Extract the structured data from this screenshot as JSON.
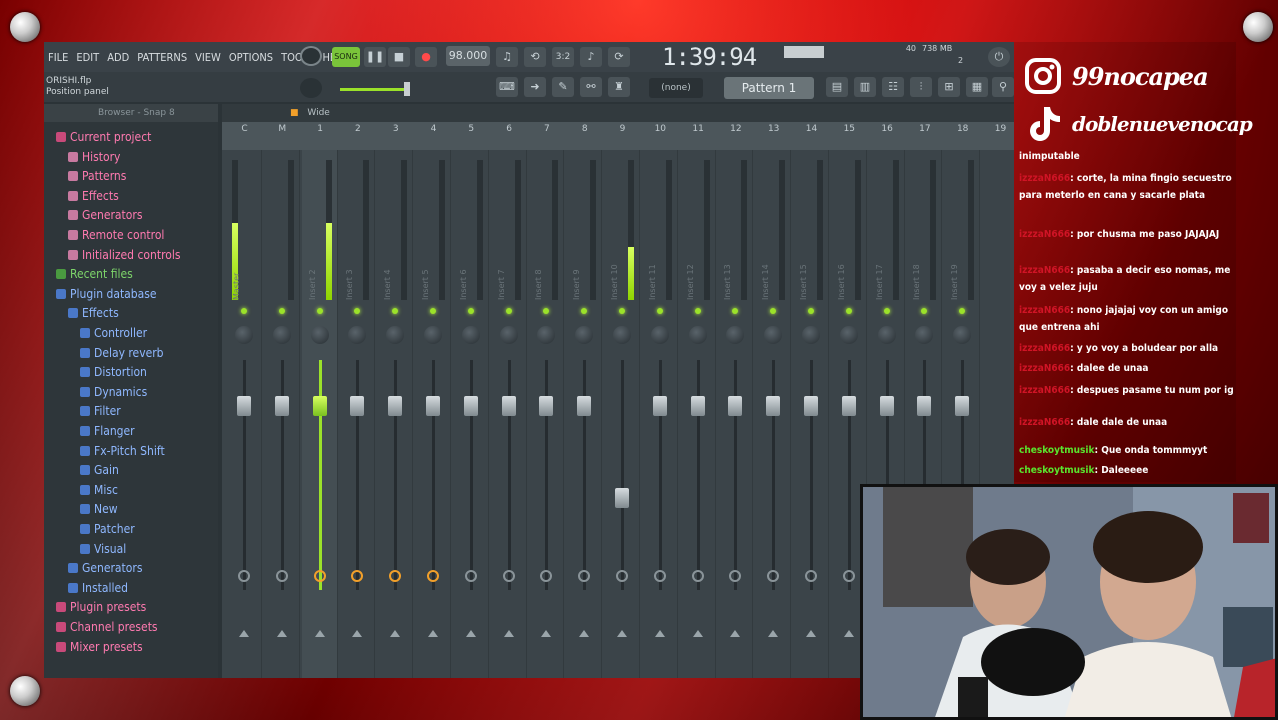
{
  "menu": [
    "FILE",
    "EDIT",
    "ADD",
    "PATTERNS",
    "VIEW",
    "OPTIONS",
    "TOOLS",
    "HELP"
  ],
  "transport": {
    "song_label": "SONG",
    "tempo": "98.000",
    "time": "1:39:94",
    "cpu": "40",
    "ram": "738 MB",
    "voices": "2"
  },
  "hint": {
    "file": "ORISHI.flp",
    "panel": "Position panel"
  },
  "pattern": {
    "none": "(none)",
    "current": "Pattern 1"
  },
  "browser": {
    "header": "Browser - Snap 8",
    "items": [
      {
        "label": "Current project",
        "color": "#ff7ab0",
        "icon": "#c84a7a",
        "indent": 0
      },
      {
        "label": "History",
        "color": "#ff7ab0",
        "icon": "#c87aa0",
        "indent": 1
      },
      {
        "label": "Patterns",
        "color": "#ff7ab0",
        "icon": "#c87aa0",
        "indent": 1
      },
      {
        "label": "Effects",
        "color": "#ff7ab0",
        "icon": "#c87aa0",
        "indent": 1
      },
      {
        "label": "Generators",
        "color": "#ff7ab0",
        "icon": "#c87aa0",
        "indent": 1
      },
      {
        "label": "Remote control",
        "color": "#ff7ab0",
        "icon": "#c87aa0",
        "indent": 1
      },
      {
        "label": "Initialized controls",
        "color": "#ff7ab0",
        "icon": "#c87aa0",
        "indent": 1
      },
      {
        "label": "Recent files",
        "color": "#7dd46a",
        "icon": "#4a9a40",
        "indent": 0
      },
      {
        "label": "Plugin database",
        "color": "#8fb8ff",
        "icon": "#4a78c8",
        "indent": 0
      },
      {
        "label": "Effects",
        "color": "#8fb8ff",
        "icon": "#4a78c8",
        "indent": 1
      },
      {
        "label": "Controller",
        "color": "#8fb8ff",
        "icon": "#4a78c8",
        "indent": 2
      },
      {
        "label": "Delay reverb",
        "color": "#8fb8ff",
        "icon": "#4a78c8",
        "indent": 2
      },
      {
        "label": "Distortion",
        "color": "#8fb8ff",
        "icon": "#4a78c8",
        "indent": 2
      },
      {
        "label": "Dynamics",
        "color": "#8fb8ff",
        "icon": "#4a78c8",
        "indent": 2
      },
      {
        "label": "Filter",
        "color": "#8fb8ff",
        "icon": "#4a78c8",
        "indent": 2
      },
      {
        "label": "Flanger",
        "color": "#8fb8ff",
        "icon": "#4a78c8",
        "indent": 2
      },
      {
        "label": "Fx-Pitch Shift",
        "color": "#8fb8ff",
        "icon": "#4a78c8",
        "indent": 2
      },
      {
        "label": "Gain",
        "color": "#8fb8ff",
        "icon": "#4a78c8",
        "indent": 2
      },
      {
        "label": "Misc",
        "color": "#8fb8ff",
        "icon": "#4a78c8",
        "indent": 2
      },
      {
        "label": "New",
        "color": "#8fb8ff",
        "icon": "#4a78c8",
        "indent": 2
      },
      {
        "label": "Patcher",
        "color": "#8fb8ff",
        "icon": "#4a78c8",
        "indent": 2
      },
      {
        "label": "Visual",
        "color": "#8fb8ff",
        "icon": "#4a78c8",
        "indent": 2
      },
      {
        "label": "Generators",
        "color": "#8fb8ff",
        "icon": "#4a78c8",
        "indent": 1
      },
      {
        "label": "Installed",
        "color": "#8fb8ff",
        "icon": "#4a78c8",
        "indent": 1
      },
      {
        "label": "Plugin presets",
        "color": "#ff7ab0",
        "icon": "#c84a7a",
        "indent": 0
      },
      {
        "label": "Channel presets",
        "color": "#ff7ab0",
        "icon": "#c84a7a",
        "indent": 0
      },
      {
        "label": "Mixer presets",
        "color": "#ff7ab0",
        "icon": "#c84a7a",
        "indent": 0
      }
    ]
  },
  "mixer": {
    "view_label": "Wide",
    "ruler": [
      "C",
      "M",
      "1",
      "2",
      "3",
      "4",
      "5",
      "6",
      "7",
      "8",
      "9",
      "10",
      "11",
      "12",
      "13",
      "14",
      "15",
      "16",
      "17",
      "18",
      "19"
    ],
    "tracks": [
      {
        "name": "Master",
        "level": 0.55,
        "fader": 0.2,
        "route": false
      },
      {
        "name": "",
        "level": 0,
        "fader": 0.2,
        "route": false
      },
      {
        "name": "Insert 2",
        "level": 0.55,
        "fader": 0.2,
        "route": true
      },
      {
        "name": "Insert 3",
        "level": 0,
        "fader": 0.2,
        "route": true
      },
      {
        "name": "Insert 4",
        "level": 0,
        "fader": 0.2,
        "route": true
      },
      {
        "name": "Insert 5",
        "level": 0,
        "fader": 0.2,
        "route": true
      },
      {
        "name": "Insert 6",
        "level": 0,
        "fader": 0.2,
        "route": false
      },
      {
        "name": "Insert 7",
        "level": 0,
        "fader": 0.2,
        "route": false
      },
      {
        "name": "Insert 8",
        "level": 0,
        "fader": 0.2,
        "route": false
      },
      {
        "name": "Insert 9",
        "level": 0,
        "fader": 0.2,
        "route": false
      },
      {
        "name": "Insert 10",
        "level": 0.38,
        "fader": 0.6,
        "route": false
      },
      {
        "name": "Insert 11",
        "level": 0,
        "fader": 0.2,
        "route": false
      },
      {
        "name": "Insert 12",
        "level": 0,
        "fader": 0.2,
        "route": false
      },
      {
        "name": "Insert 13",
        "level": 0,
        "fader": 0.2,
        "route": false
      },
      {
        "name": "Insert 14",
        "level": 0,
        "fader": 0.2,
        "route": false
      },
      {
        "name": "Insert 15",
        "level": 0,
        "fader": 0.2,
        "route": false
      },
      {
        "name": "Insert 16",
        "level": 0,
        "fader": 0.2,
        "route": false
      },
      {
        "name": "Insert 17",
        "level": 0,
        "fader": 0.2,
        "route": false
      },
      {
        "name": "Insert 18",
        "level": 0,
        "fader": 0.2,
        "route": false
      },
      {
        "name": "Insert 19",
        "level": 0,
        "fader": 0.2,
        "route": false
      }
    ]
  },
  "socials": {
    "instagram": "99nocapea",
    "tiktok": "doblenuevenocap"
  },
  "chat": [
    {
      "user": "",
      "text": "inimputable",
      "green": false
    },
    {
      "user": "izzzaN666",
      "text": ": corte, la mina fingio secuestro para meterlo en cana y sacarle plata",
      "green": false
    },
    {
      "user": "izzzaN666",
      "text": ": por chusma me paso JAJAJAJ",
      "green": false
    },
    {
      "user": "izzzaN666",
      "text": ": pasaba a decir eso nomas, me voy a velez juju",
      "green": false
    },
    {
      "user": "izzzaN666",
      "text": ": nono jajajaj voy con un amigo que entrena ahi",
      "green": false
    },
    {
      "user": "izzzaN666",
      "text": ": y yo voy a boludear por alla",
      "green": false
    },
    {
      "user": "izzzaN666",
      "text": ": dalee de unaa",
      "green": false
    },
    {
      "user": "izzzaN666",
      "text": ": despues pasame tu num por ig",
      "green": false
    },
    {
      "user": "izzzaN666",
      "text": ": dale dale de unaa",
      "green": false
    },
    {
      "user": "cheskoytmusik",
      "text": ": Que onda tommmyyt",
      "green": true
    },
    {
      "user": "cheskoytmusik",
      "text": ": Daleeeee",
      "green": true
    }
  ]
}
